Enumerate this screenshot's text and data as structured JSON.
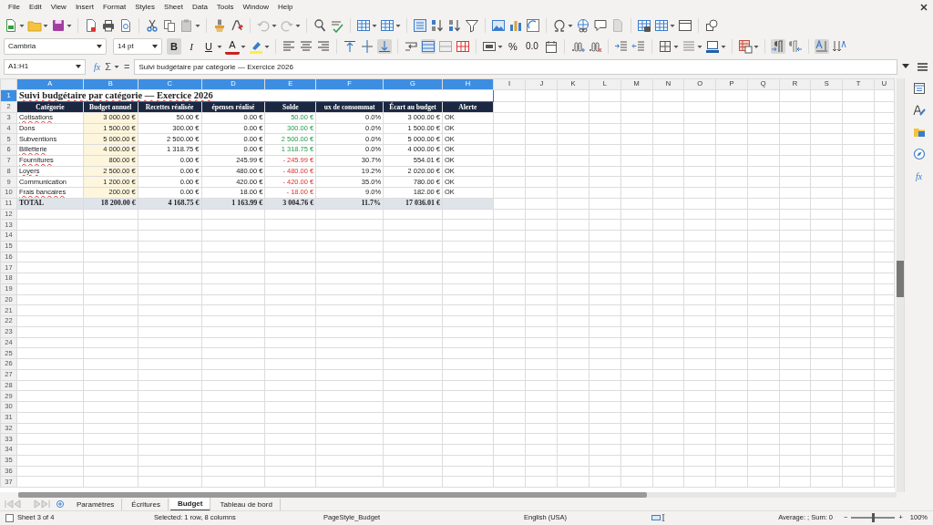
{
  "menu": [
    "File",
    "Edit",
    "View",
    "Insert",
    "Format",
    "Styles",
    "Sheet",
    "Data",
    "Tools",
    "Window",
    "Help"
  ],
  "format_bar": {
    "font": "Cambria",
    "size": "14 pt",
    "bold": {
      "label": "B",
      "on": true
    },
    "italic": {
      "label": "I",
      "on": false
    },
    "underline": {
      "label": "U",
      "on": false
    },
    "font_color": {
      "label": "A",
      "color": "#c9211e"
    },
    "percent": {
      "label": "%"
    },
    "decimal": {
      "label": "0.0"
    },
    "pressed": {
      "align_bottom": true,
      "merge_center": true,
      "left_to_right": true,
      "vertical_text": true
    }
  },
  "formula_bar": {
    "name_box": "A1:H1",
    "function_label": "fx",
    "sum_label": "Σ",
    "equals_label": "=",
    "content": "Suivi budgétaire par catégorie — Exercice 2026"
  },
  "sheet": {
    "columns": [
      {
        "label": "A",
        "selected": true
      },
      {
        "label": "B",
        "selected": true
      },
      {
        "label": "C",
        "selected": true
      },
      {
        "label": "D",
        "selected": true
      },
      {
        "label": "E",
        "selected": true
      },
      {
        "label": "F",
        "selected": true
      },
      {
        "label": "G",
        "selected": true
      },
      {
        "label": "H",
        "selected": true
      },
      {
        "label": "I",
        "selected": false
      },
      {
        "label": "J",
        "selected": false
      },
      {
        "label": "K",
        "selected": false
      },
      {
        "label": "L",
        "selected": false
      },
      {
        "label": "M",
        "selected": false
      },
      {
        "label": "N",
        "selected": false
      },
      {
        "label": "O",
        "selected": false
      },
      {
        "label": "P",
        "selected": false
      },
      {
        "label": "Q",
        "selected": false
      },
      {
        "label": "R",
        "selected": false
      },
      {
        "label": "S",
        "selected": false
      },
      {
        "label": "T",
        "selected": false
      },
      {
        "label": "U",
        "selected": false
      }
    ],
    "rows": [
      {
        "label": "1",
        "selected": true
      },
      {
        "label": "2",
        "selected": false
      },
      {
        "label": "3",
        "selected": false
      },
      {
        "label": "4",
        "selected": false
      },
      {
        "label": "5",
        "selected": false
      },
      {
        "label": "6",
        "selected": false
      },
      {
        "label": "7",
        "selected": false
      },
      {
        "label": "8",
        "selected": false
      },
      {
        "label": "9",
        "selected": false
      },
      {
        "label": "10",
        "selected": false
      },
      {
        "label": "11",
        "selected": false
      },
      {
        "label": "12",
        "selected": false
      },
      {
        "label": "13",
        "selected": false
      },
      {
        "label": "14",
        "selected": false
      },
      {
        "label": "15",
        "selected": false
      },
      {
        "label": "16",
        "selected": false
      },
      {
        "label": "17",
        "selected": false
      },
      {
        "label": "18",
        "selected": false
      },
      {
        "label": "19",
        "selected": false
      },
      {
        "label": "20",
        "selected": false
      },
      {
        "label": "21",
        "selected": false
      },
      {
        "label": "22",
        "selected": false
      },
      {
        "label": "23",
        "selected": false
      },
      {
        "label": "24",
        "selected": false
      },
      {
        "label": "25",
        "selected": false
      },
      {
        "label": "26",
        "selected": false
      },
      {
        "label": "27",
        "selected": false
      },
      {
        "label": "28",
        "selected": false
      },
      {
        "label": "29",
        "selected": false
      },
      {
        "label": "30",
        "selected": false
      },
      {
        "label": "31",
        "selected": false
      },
      {
        "label": "32",
        "selected": false
      },
      {
        "label": "33",
        "selected": false
      },
      {
        "label": "34",
        "selected": false
      },
      {
        "label": "35",
        "selected": false
      },
      {
        "label": "36",
        "selected": false
      },
      {
        "label": "37",
        "selected": false
      }
    ],
    "title": {
      "text": "Suivi budgétaire par catégorie — Exercice 2026",
      "spell_error": true
    },
    "header_row": [
      "Catégorie",
      "Budget annuel",
      "Recettes réalisée",
      "épenses réalisé",
      "Solde",
      "ux de consommat",
      "Écart au budget",
      "Alerte"
    ],
    "data_rows": [
      {
        "category": "Cotisations",
        "spell_error": true,
        "budget": "3 000.00 €",
        "receipts": "50.00 €",
        "expenses": "0.00 €",
        "balance": "50.00 €",
        "negative": false,
        "rate": "0.0%",
        "variance": "3 000.00 €",
        "alert": "OK"
      },
      {
        "category": "Dons",
        "spell_error": false,
        "budget": "1 500.00 €",
        "receipts": "300.00 €",
        "expenses": "0.00 €",
        "balance": "300.00 €",
        "negative": false,
        "rate": "0.0%",
        "variance": "1 500.00 €",
        "alert": "OK"
      },
      {
        "category": "Subventions",
        "spell_error": false,
        "budget": "5 000.00 €",
        "receipts": "2 500.00 €",
        "expenses": "0.00 €",
        "balance": "2 500.00 €",
        "negative": false,
        "rate": "0.0%",
        "variance": "5 000.00 €",
        "alert": "OK"
      },
      {
        "category": "Billetterie",
        "spell_error": true,
        "budget": "4 000.00 €",
        "receipts": "1 318.75 €",
        "expenses": "0.00 €",
        "balance": "1 318.75 €",
        "negative": false,
        "rate": "0.0%",
        "variance": "4 000.00 €",
        "alert": "OK"
      },
      {
        "category": "Fournitures",
        "spell_error": true,
        "budget": "800.00 €",
        "receipts": "0.00 €",
        "expenses": "245.99 €",
        "balance": "- 245.99 €",
        "negative": true,
        "rate": "30.7%",
        "variance": "554.01 €",
        "alert": "OK"
      },
      {
        "category": "Loyers",
        "spell_error": true,
        "budget": "2 500.00 €",
        "receipts": "0.00 €",
        "expenses": "480.00 €",
        "balance": "- 480.00 €",
        "negative": true,
        "rate": "19.2%",
        "variance": "2 020.00 €",
        "alert": "OK"
      },
      {
        "category": "Communication",
        "spell_error": false,
        "budget": "1 200.00 €",
        "receipts": "0.00 €",
        "expenses": "420.00 €",
        "balance": "- 420.00 €",
        "negative": true,
        "rate": "35.0%",
        "variance": "780.00 €",
        "alert": "OK"
      },
      {
        "category": "Frais bancaires",
        "spell_error": true,
        "budget": "200.00 €",
        "receipts": "0.00 €",
        "expenses": "18.00 €",
        "balance": "- 18.00 €",
        "negative": true,
        "rate": "9.0%",
        "variance": "182.00 €",
        "alert": "OK"
      }
    ],
    "total_row": {
      "label": "TOTAL",
      "budget": "18 200.00 €",
      "receipts": "4 168.75 €",
      "expenses": "1 163.99 €",
      "balance": "3 004.76 €",
      "rate": "11.7%",
      "variance": "17 036.01 €"
    }
  },
  "sheet_tabs": [
    {
      "label": "Paramètres",
      "selected": false
    },
    {
      "label": "Écritures",
      "selected": false
    },
    {
      "label": "Budget",
      "selected": true
    },
    {
      "label": "Tableau de bord",
      "selected": false
    }
  ],
  "sidebar": {
    "function_label": "fx"
  },
  "status_bar": {
    "sheet": "Sheet 3 of 4",
    "selection": "Selected: 1 row, 8 columns",
    "page_style": "PageStyle_Budget",
    "language": "English (USA)",
    "summary": "Average: ; Sum: 0",
    "zoom_minus": "−",
    "zoom_plus": "+",
    "zoom": {
      "level": 0.5
    },
    "zoom_value": "100%"
  }
}
